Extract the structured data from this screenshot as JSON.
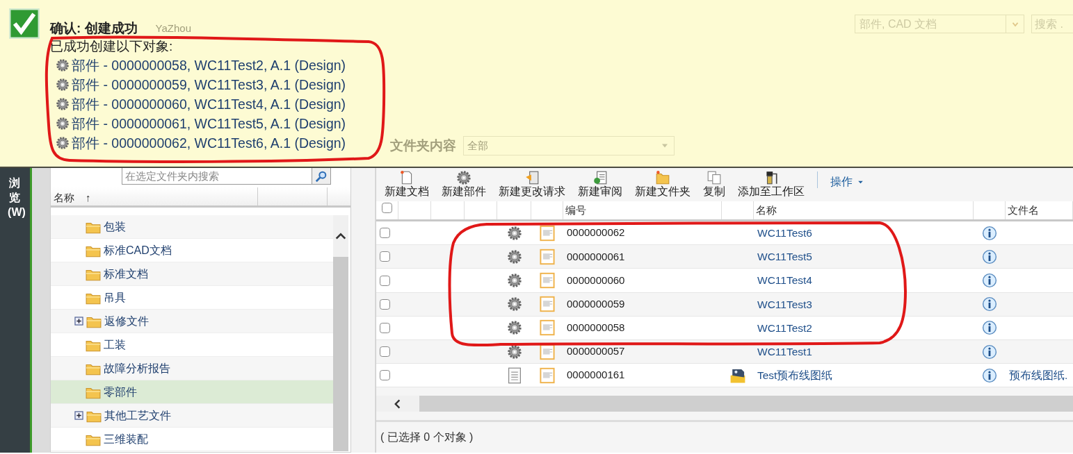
{
  "banner": {
    "title": "确认: 创建成功",
    "user": "YaZhou",
    "message": "已成功创建以下对象:",
    "items": [
      {
        "text": "部件 - 0000000058, WC11Test2, A.1 (Design)"
      },
      {
        "text": "部件 - 0000000059, WC11Test3, A.1 (Design)"
      },
      {
        "text": "部件 - 0000000060, WC11Test4, A.1 (Design)"
      },
      {
        "text": "部件 - 0000000061, WC11Test5, A.1 (Design)"
      },
      {
        "text": "部件 - 0000000062, WC11Test6, A.1 (Design)"
      }
    ]
  },
  "search_bar": {
    "type_filter": "部件, CAD 文档",
    "placeholder": "搜索 ."
  },
  "folder_contents": {
    "title": "文件夹内容",
    "filter": "全部"
  },
  "sidebar": {
    "tab": "浏览(W)"
  },
  "tree": {
    "search_placeholder": "在选定文件夹内搜索",
    "column": "名称",
    "sort_arrow": "↑",
    "items": [
      {
        "label": "包装",
        "selected": false
      },
      {
        "label": "标准CAD文档",
        "selected": false
      },
      {
        "label": "标准文档",
        "selected": false
      },
      {
        "label": "吊具",
        "selected": false
      },
      {
        "label": "返修文件",
        "selected": false,
        "expanded": false
      },
      {
        "label": "工装",
        "selected": false
      },
      {
        "label": "故障分析报告",
        "selected": false
      },
      {
        "label": "零部件",
        "selected": true
      },
      {
        "label": "其他工艺文件",
        "selected": false,
        "expanded": false
      },
      {
        "label": "三维装配",
        "selected": false
      }
    ]
  },
  "toolbar": {
    "buttons": [
      {
        "label": "新建文档",
        "kind": "document"
      },
      {
        "label": "新建部件",
        "kind": "part"
      },
      {
        "label": "新建更改请求",
        "kind": "change"
      },
      {
        "label": "新建审阅",
        "kind": "review"
      },
      {
        "label": "新建文件夹",
        "kind": "folder"
      },
      {
        "label": "复制",
        "kind": "copy"
      },
      {
        "label": "添加至工作区",
        "kind": "workspace"
      }
    ],
    "menu": "操作"
  },
  "table": {
    "select_all_checked": false,
    "columns": {
      "number": "编号",
      "name": "名称",
      "file_name": "文件名"
    },
    "rows": [
      {
        "checked": false,
        "kind": "part",
        "number": "0000000062",
        "name": "WC11Test6"
      },
      {
        "checked": false,
        "kind": "part",
        "number": "0000000061",
        "name": "WC11Test5"
      },
      {
        "checked": false,
        "kind": "part",
        "number": "0000000060",
        "name": "WC11Test4"
      },
      {
        "checked": false,
        "kind": "part",
        "number": "0000000059",
        "name": "WC11Test3"
      },
      {
        "checked": false,
        "kind": "part",
        "number": "0000000058",
        "name": "WC11Test2"
      },
      {
        "checked": false,
        "kind": "part",
        "number": "0000000057",
        "name": "WC11Test1"
      },
      {
        "checked": false,
        "kind": "document",
        "number": "0000000161",
        "name": "Test预布线图纸",
        "file_name": "预布线图纸."
      }
    ]
  },
  "status": "( 已选择 0 个对象 )"
}
